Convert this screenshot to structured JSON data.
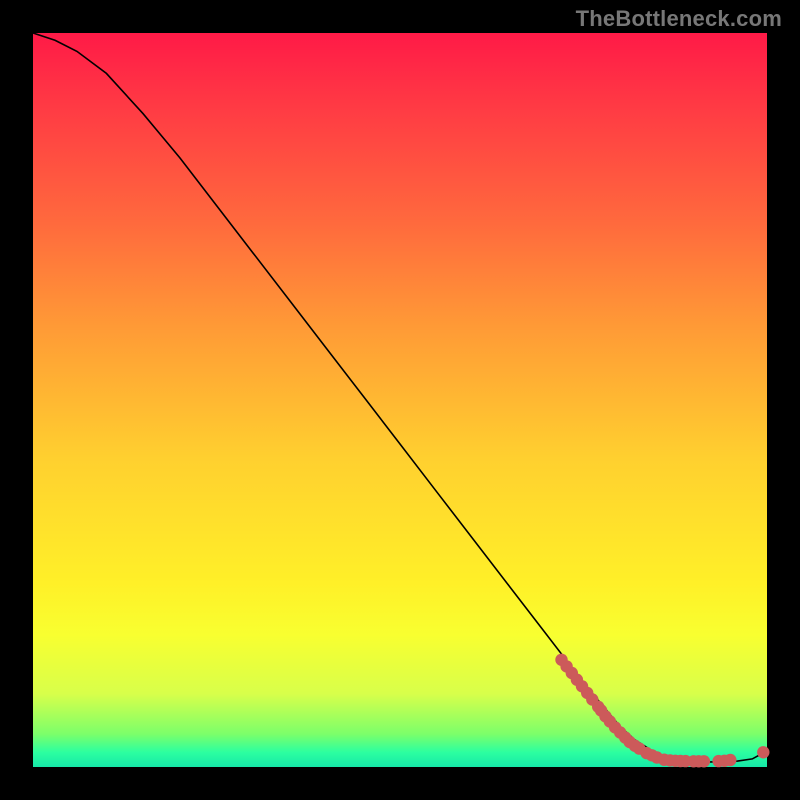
{
  "watermark": "TheBottleneck.com",
  "colors": {
    "frame": "#000000",
    "watermark": "#777777",
    "curve": "#000000",
    "dot": "#cc5a5a",
    "gradient_top": "#ff1a47",
    "gradient_mid": "#ffe028",
    "gradient_bottom": "#16e8a8"
  },
  "chart_data": {
    "type": "line",
    "title": "",
    "xlabel": "",
    "ylabel": "",
    "xlim": [
      0,
      100
    ],
    "ylim": [
      0,
      100
    ],
    "grid": false,
    "legend": null,
    "series": [
      {
        "name": "curve",
        "kind": "line",
        "x": [
          0,
          3,
          6,
          10,
          15,
          20,
          25,
          30,
          35,
          40,
          45,
          50,
          55,
          60,
          65,
          70,
          75,
          80,
          82,
          85,
          88,
          90,
          92,
          94,
          96,
          98,
          100
        ],
        "y": [
          100,
          99,
          97.5,
          94.5,
          89,
          83,
          76.5,
          70,
          63.5,
          57,
          50.5,
          44,
          37.5,
          31,
          24.5,
          18,
          11.5,
          5.5,
          3.7,
          1.8,
          0.9,
          0.7,
          0.7,
          0.7,
          0.8,
          1.1,
          2.2
        ]
      },
      {
        "name": "points",
        "kind": "scatter",
        "x": [
          72,
          72.7,
          73.4,
          74.1,
          74.8,
          75.5,
          76.2,
          77,
          77.4,
          78,
          78.6,
          79.3,
          80,
          80.7,
          81.3,
          82,
          82.6,
          83.6,
          84.3,
          85,
          86,
          86.8,
          87.5,
          88.2,
          88.9,
          90,
          90.7,
          91.4,
          93.4,
          94.2,
          95,
          99.5
        ],
        "y": [
          14.6,
          13.7,
          12.8,
          11.9,
          11.0,
          10.1,
          9.2,
          8.2,
          7.7,
          6.9,
          6.2,
          5.4,
          4.7,
          4.0,
          3.4,
          2.9,
          2.5,
          1.9,
          1.6,
          1.3,
          1.0,
          0.9,
          0.85,
          0.82,
          0.8,
          0.78,
          0.77,
          0.77,
          0.8,
          0.85,
          0.95,
          2.0
        ]
      }
    ]
  }
}
